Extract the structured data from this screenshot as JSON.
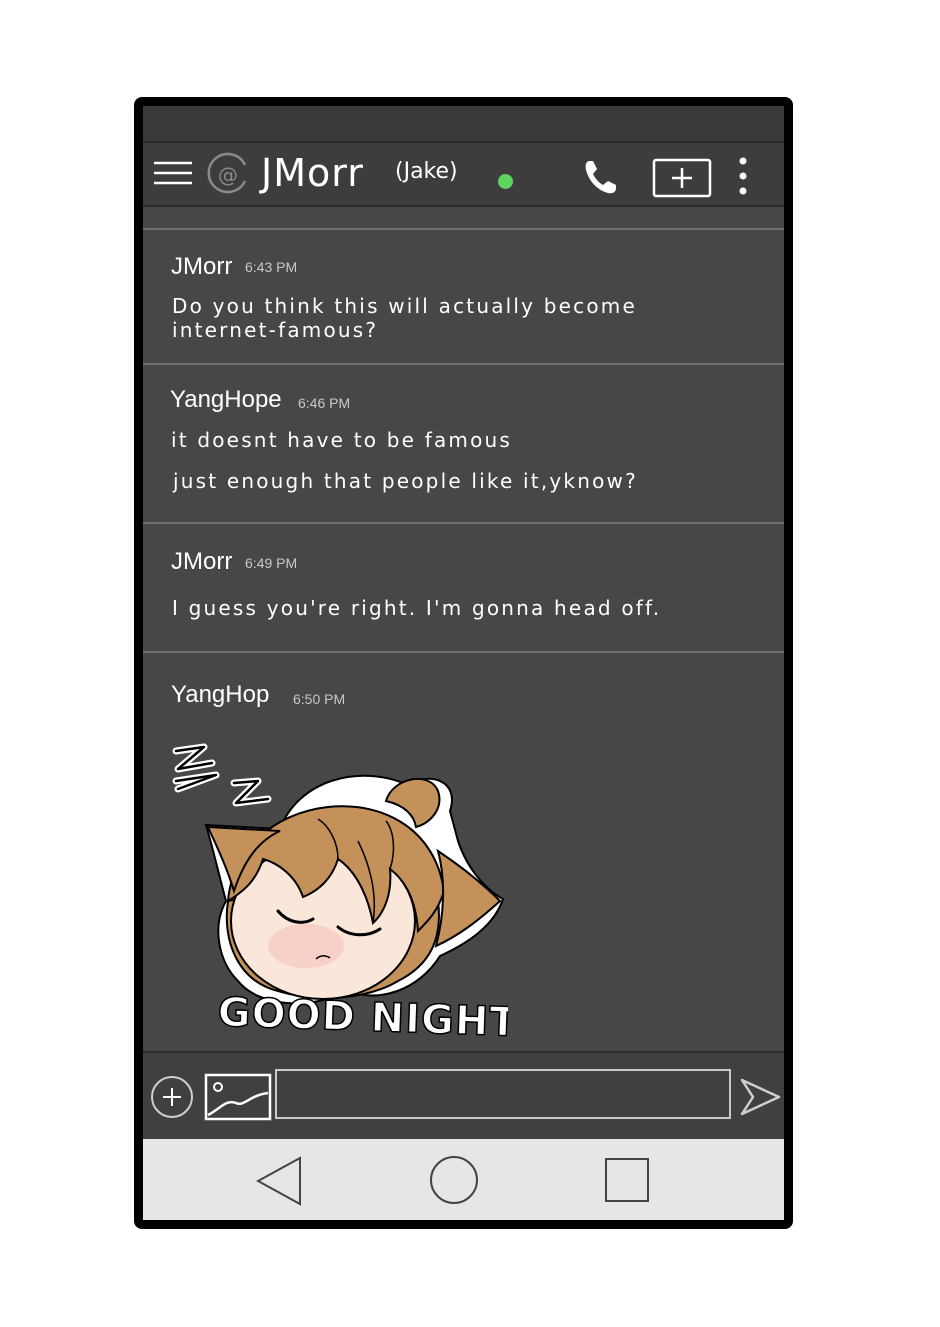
{
  "header": {
    "at_symbol": "@",
    "username": "JMorr",
    "display_name": "(Jake)",
    "status_color": "#5ed35e",
    "icons": [
      "menu-icon",
      "phone-icon",
      "add-icon",
      "more-vert-icon"
    ]
  },
  "messages": [
    {
      "name": "JMorr",
      "time": "6:43 PM",
      "lines": [
        "Do you think this will actually become",
        "internet-famous?"
      ]
    },
    {
      "name": "YangHope",
      "time": "6:46 PM",
      "lines": [
        "it doesnt have to be famous",
        "just enough that people like it,yknow?"
      ]
    },
    {
      "name": "JMorr",
      "time": "6:49 PM",
      "lines": [
        "I guess you're right. I'm gonna head off."
      ]
    },
    {
      "name": "YangHop",
      "time": "6:50 PM",
      "sticker": "sleeping-girl-sticker",
      "sticker_text": "GOOD NIGHT!",
      "sticker_sleep": "Z Z"
    }
  ],
  "composer": {
    "input_value": "",
    "icons": [
      "add-circle-icon",
      "image-icon",
      "send-icon"
    ]
  },
  "navigation": {
    "icons": [
      "back-icon",
      "home-icon",
      "recents-icon"
    ]
  }
}
